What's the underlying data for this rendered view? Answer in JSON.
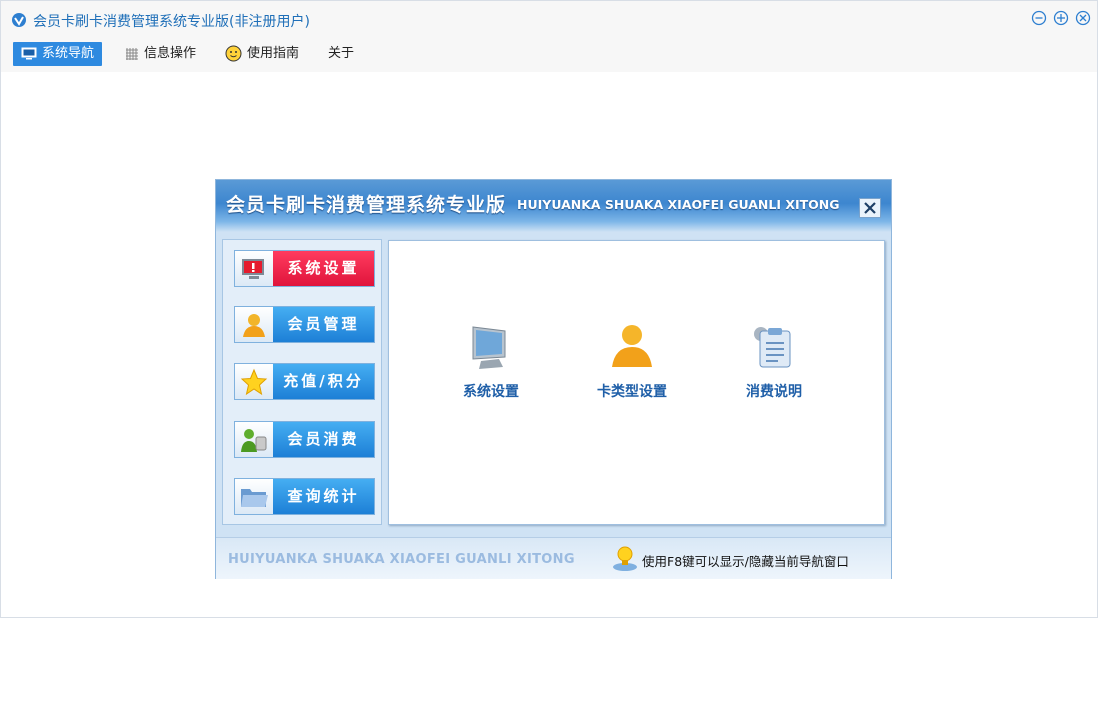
{
  "window": {
    "title": "会员卡刷卡消费管理系统专业版(非注册用户)",
    "buttons": {
      "minimize_icon": "minimize-icon",
      "maximize_icon": "maximize-icon",
      "close_icon": "close-icon"
    }
  },
  "menu": {
    "items": [
      {
        "label": "系统导航",
        "icon": "monitor-icon",
        "active": true
      },
      {
        "label": "信息操作",
        "icon": "grid-icon",
        "active": false
      },
      {
        "label": "使用指南",
        "icon": "smiley-icon",
        "active": false
      },
      {
        "label": "关于",
        "icon": "",
        "active": false
      }
    ]
  },
  "dialog": {
    "title_cn": "会员卡刷卡消费管理系统专业版",
    "title_en": "HUIYUANKA SHUAKA XIAOFEI GUANLI XITONG",
    "nav": [
      {
        "label": "系统设置",
        "icon": "warning-monitor-icon",
        "active": true
      },
      {
        "label": "会员管理",
        "icon": "user-icon",
        "active": false
      },
      {
        "label": "充值/积分",
        "icon": "star-icon",
        "active": false
      },
      {
        "label": "会员消费",
        "icon": "users-icon",
        "active": false
      },
      {
        "label": "查询统计",
        "icon": "folder-icon",
        "active": false
      }
    ],
    "tiles": [
      {
        "label": "系统设置",
        "icon": "monitor-icon"
      },
      {
        "label": "卡类型设置",
        "icon": "user-icon"
      },
      {
        "label": "消费说明",
        "icon": "clipboard-icon"
      }
    ],
    "footer": {
      "brand": "HUIYUANKA SHUAKA XIAOFEI GUANLI XITONG",
      "tip": "使用F8键可以显示/隐藏当前导航窗口",
      "tip_icon": "lightbulb-icon"
    }
  },
  "colors": {
    "accent": "#2e8ae0",
    "title_text": "#1f6fb8",
    "active_nav": "#e0143c",
    "nav_blue": "#1d7fd6"
  }
}
